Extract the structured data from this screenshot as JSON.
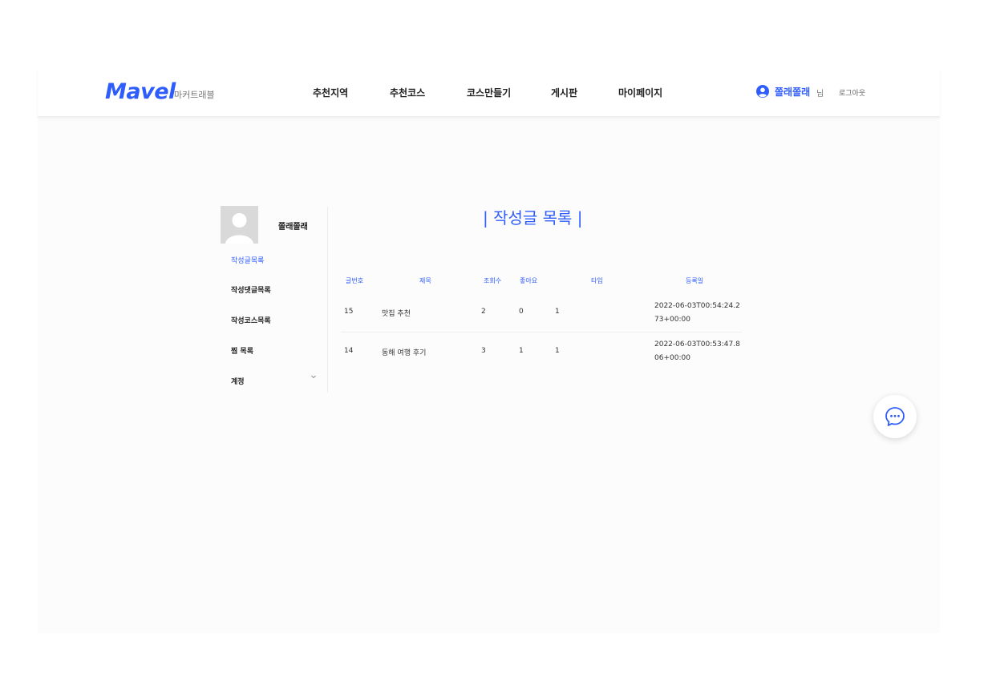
{
  "header": {
    "logo": "Mavel",
    "logo_sub": "마커트래블",
    "nav": [
      "추천지역",
      "추천코스",
      "코스만들기",
      "게시판",
      "마이페이지"
    ],
    "user_name": "쫄래쫄래",
    "user_suffix": "님",
    "logout": "로그아웃",
    "accent_color": "#2f5dfc"
  },
  "sidebar": {
    "profile_name": "쫄래쫄래",
    "items": [
      "작성글목록",
      "작성댓글목록",
      "작성코스목록",
      "찜 목록",
      "계정"
    ],
    "active_index": 0
  },
  "main": {
    "title": "| 작성글 목록 |",
    "table": {
      "columns": [
        "글번호",
        "제목",
        "조회수",
        "좋아요",
        "타입",
        "등록일"
      ],
      "rows": [
        [
          "15",
          "맛집 추천",
          "2",
          "0",
          "1",
          "2022-06-03T00:54:24.2",
          "73+00:00"
        ],
        [
          "14",
          "동해 여행 후기",
          "3",
          "1",
          "1",
          "2022-06-03T00:53:47.8",
          "06+00:00"
        ]
      ]
    }
  },
  "icons": {
    "user": "user-circle-icon",
    "chevron": "chevron-down-icon",
    "chat": "chat-bubble-icon"
  }
}
